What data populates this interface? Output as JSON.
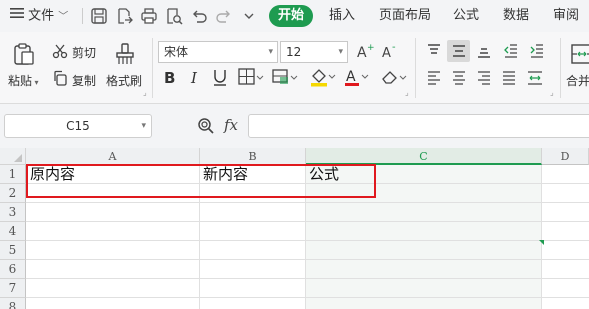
{
  "menu": {
    "file_label": "文件",
    "tabs": [
      "开始",
      "插入",
      "页面布局",
      "公式",
      "数据",
      "审阅"
    ]
  },
  "ribbon": {
    "paste_label": "粘贴",
    "cut_label": "剪切",
    "copy_label": "复制",
    "format_painter_label": "格式刷",
    "font_name": "宋体",
    "font_size": "12",
    "merge_label": "合并"
  },
  "formula_bar": {
    "cell_ref": "C15",
    "fx_label": "fx",
    "formula": ""
  },
  "sheet": {
    "columns": [
      "A",
      "B",
      "C",
      "D"
    ],
    "selected_column": "C",
    "rows": [
      "1",
      "2",
      "3",
      "4",
      "5",
      "6",
      "7",
      "8"
    ],
    "cells": {
      "A1": "原内容",
      "B1": "新内容",
      "C1": "公式"
    }
  },
  "colors": {
    "accent": "#1e9b50",
    "highlight_box": "#e0191e",
    "font_color": "#e0191e",
    "fill_color": "#f5d800"
  }
}
